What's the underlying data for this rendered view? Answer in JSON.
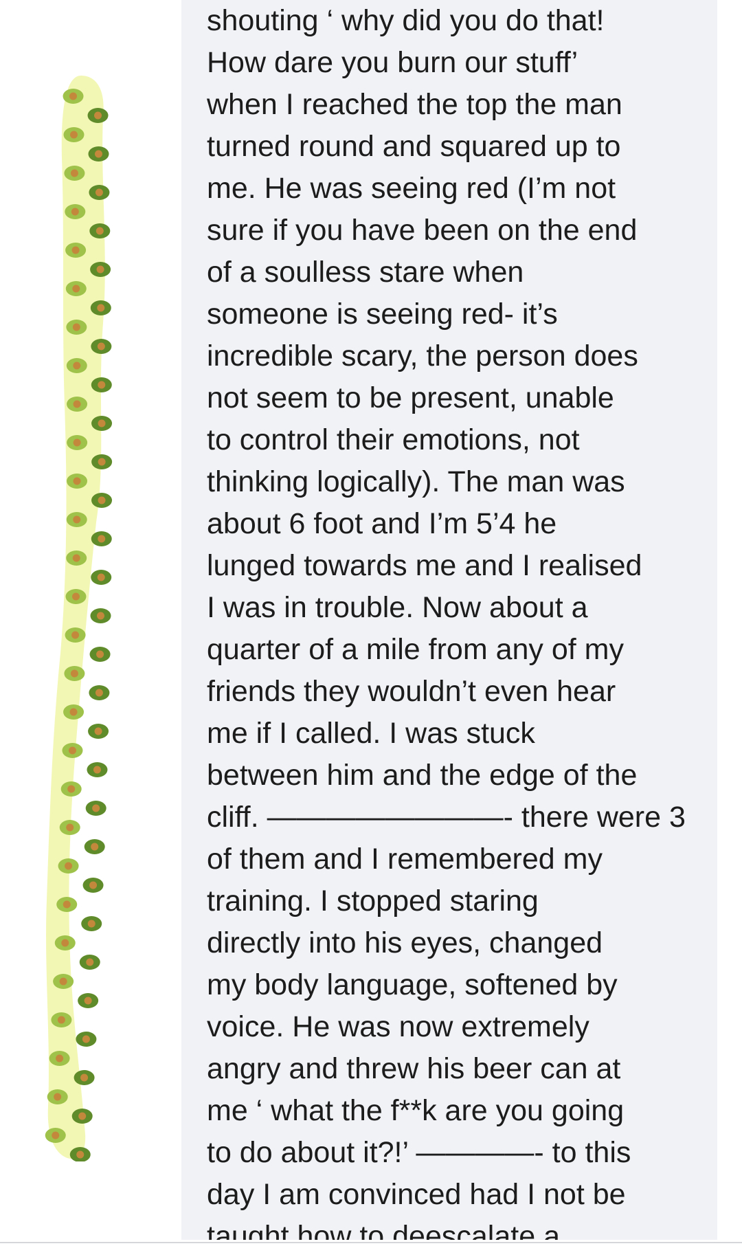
{
  "post": {
    "lines": [
      "shouting ‘ why did you do that!",
      "How dare you burn our stuff’",
      "when I reached the top the man",
      "turned round and squared up to",
      "me. He was seeing red (I’m not",
      "sure if you have been on the end",
      "of a soulless stare when",
      "someone is seeing red- it’s",
      "incredible scary, the person does",
      "not seem to be present, unable",
      "to control their emotions, not",
      "thinking logically). The man was",
      "about 6 foot and I’m 5’4 he",
      "lunged towards me and I realised",
      "I was in trouble. Now about a",
      "quarter of a mile from any of my",
      "friends they wouldn’t even hear",
      "me if I called. I was stuck",
      "between him and the edge of the",
      "cliff. ————————- there were 3",
      "of them and I remembered my",
      "training. I stopped staring",
      "directly into his eyes, changed",
      "my body language, softened by",
      "voice. He was now extremely",
      "angry and threw his beer can at",
      "me ‘ what the f**k are you going",
      "to do about it?!’ ————- to this",
      "day I am convinced had I not be",
      "taught how to deescalate a"
    ]
  },
  "colors": {
    "bubble": "#f0f2f5",
    "text": "#1c1c1c",
    "strip_fill": "#f3f7b4",
    "seed_light": "#9fc24a",
    "seed_dark": "#5f8b2a",
    "pit": "#c4883c"
  },
  "icons": {
    "avatar": "avocado-pattern-icon"
  }
}
